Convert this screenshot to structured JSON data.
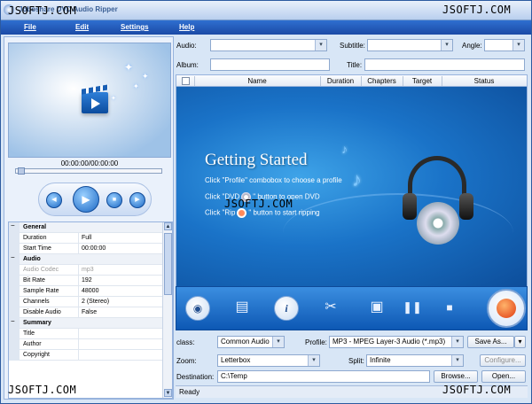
{
  "window": {
    "title": "Joboshare DVD Audio Ripper"
  },
  "watermarks": [
    "JSOFTJ.COM",
    "JSOFTJ.COM",
    "JSOFTJ.COM",
    "JSOFTJ.COM",
    "JSOFTJ.COM"
  ],
  "menu": [
    "File",
    "Edit",
    "Settings",
    "Help"
  ],
  "player": {
    "timecode": "00:00:00/00:00:00",
    "seek_fraction": 0.0
  },
  "properties": [
    {
      "type": "group",
      "label": "General"
    },
    {
      "label": "Duration",
      "value": "Full"
    },
    {
      "label": "Start Time",
      "value": "00:00:00"
    },
    {
      "type": "group",
      "label": "Audio"
    },
    {
      "label": "Audio Codec",
      "value": "mp3",
      "disabled": true
    },
    {
      "label": "Bit Rate",
      "value": "192"
    },
    {
      "label": "Sample Rate",
      "value": "48000"
    },
    {
      "label": "Channels",
      "value": "2 (Stereo)"
    },
    {
      "label": "Disable Audio",
      "value": "False"
    },
    {
      "type": "group",
      "label": "Summary"
    },
    {
      "label": "Title",
      "value": ""
    },
    {
      "label": "Author",
      "value": ""
    },
    {
      "label": "Copyright",
      "value": ""
    }
  ],
  "top_fields": {
    "audio_label": "Audio:",
    "audio_value": "",
    "subtitle_label": "Subtitle:",
    "subtitle_value": "",
    "angle_label": "Angle:",
    "angle_value": "",
    "album_label": "Album:",
    "album_value": "",
    "title_label": "Title:",
    "title_value": ""
  },
  "table": {
    "columns": [
      "Name",
      "Duration",
      "Chapters",
      "Target",
      "Status"
    ]
  },
  "getting_started": {
    "heading": "Getting Started",
    "line1": "Click \"Profile\" combobox to choose a profile",
    "line2a": "Click \"DVD",
    "line2b": "\" button to open DVD",
    "line3a": "Click \"Rip",
    "line3b": "\" button to start ripping"
  },
  "bottom": {
    "class_label": "class:",
    "class_value": "Common Audio",
    "profile_label": "Profile:",
    "profile_value": "MP3 - MPEG Layer-3 Audio  (*.mp3)",
    "save_as": "Save As...",
    "zoom_label": "Zoom:",
    "zoom_value": "Letterbox",
    "split_label": "Split:",
    "split_value": "Infinite",
    "configure": "Configure...",
    "destination_label": "Destination:",
    "destination_value": "C:\\Temp",
    "browse": "Browse...",
    "open": "Open..."
  },
  "status": "Ready",
  "colors": {
    "menubar": "#1b4aa6",
    "stage": "#1a73c8",
    "panel": "#d8e6f6"
  }
}
